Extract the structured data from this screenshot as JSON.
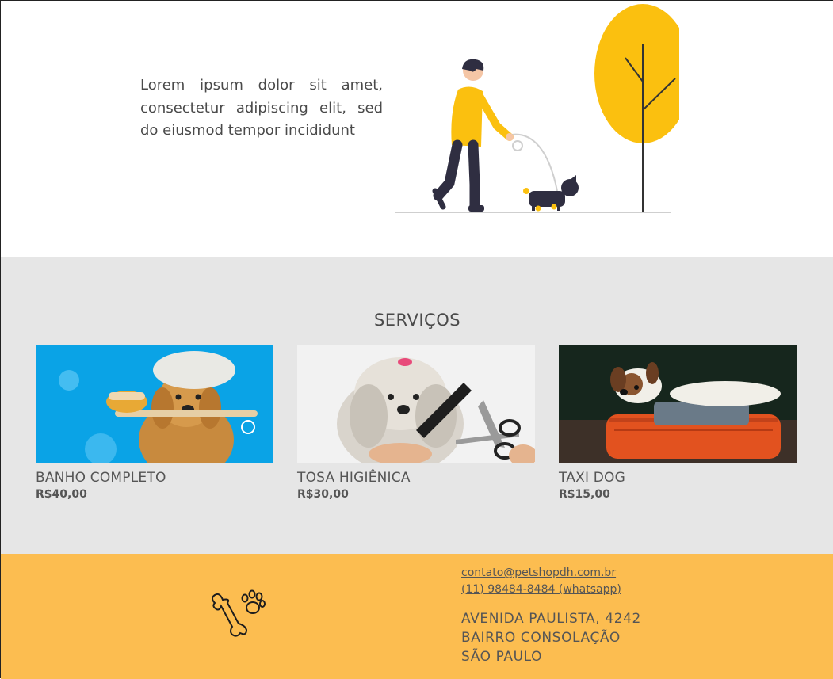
{
  "hero": {
    "text": "Lorem ipsum dolor sit amet, consectetur adipiscing elit, sed do eiusmod tempor incididunt",
    "illustration_icon": "person-walking-dog-illustration"
  },
  "services": {
    "title": "SERVIÇOS",
    "items": [
      {
        "name": "BANHO COMPLETO",
        "price": "R$40,00",
        "image_icon": "dog-bath-photo"
      },
      {
        "name": "TOSA HIGIÊNICA",
        "price": "R$30,00",
        "image_icon": "dog-grooming-photo"
      },
      {
        "name": "TAXI DOG",
        "price": "R$15,00",
        "image_icon": "dog-on-suitcase-photo"
      }
    ]
  },
  "footer": {
    "logo_icon": "bone-and-paw-icon",
    "email": "contato@petshopdh.com.br",
    "phone": "(11) 98484-8484 (whatsapp)",
    "address": [
      "AVENIDA PAULISTA, 4242",
      "BAIRRO CONSOLAÇÃO",
      "SÃO PAULO"
    ]
  },
  "colors": {
    "accent_yellow": "#fcbd50",
    "tree_yellow": "#fbc00f",
    "services_bg": "#e6e6e6",
    "text": "#4a4a4a"
  }
}
